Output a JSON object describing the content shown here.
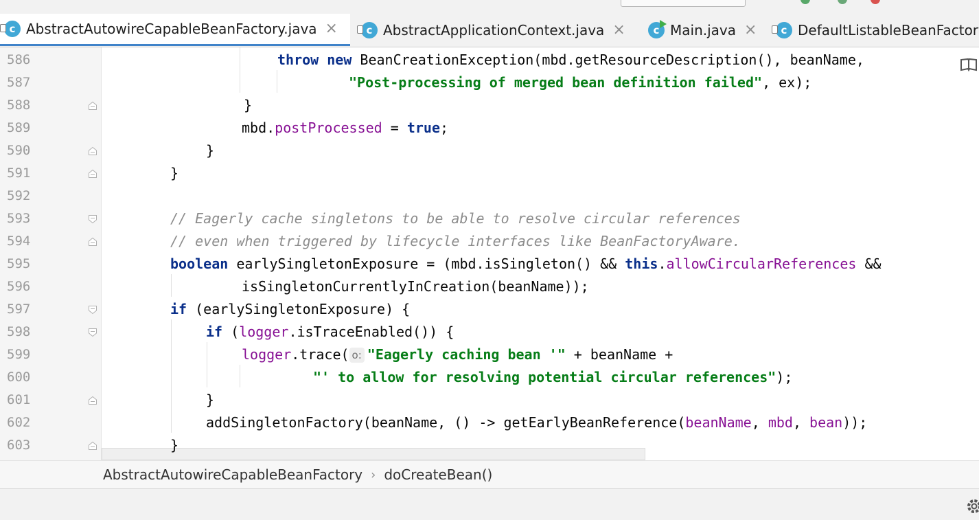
{
  "tabs": [
    {
      "label": "AbstractAutowireCapableBeanFactory.java",
      "icon": "class-icon",
      "active": true
    },
    {
      "label": "AbstractApplicationContext.java",
      "icon": "class-icon",
      "active": false
    },
    {
      "label": "Main.java",
      "icon": "class-run-icon",
      "active": false
    },
    {
      "label": "DefaultListableBeanFactory.java",
      "icon": "class-icon",
      "active": false
    }
  ],
  "editor": {
    "line_numbers": [
      "586",
      "587",
      "588",
      "589",
      "590",
      "591",
      "592",
      "593",
      "594",
      "595",
      "596",
      "597",
      "598",
      "599",
      "600",
      "601",
      "602",
      "603"
    ],
    "lines": [
      [
        {
          "t": "throw",
          "c": "kw"
        },
        {
          "t": " "
        },
        {
          "t": "new",
          "c": "kw"
        },
        {
          "t": " BeanCreationException(mbd.getResourceDescription(), beanName,"
        }
      ],
      [
        {
          "t": "\"Post-processing of merged bean definition failed\"",
          "c": "str"
        },
        {
          "t": ", ex);"
        }
      ],
      [
        {
          "t": "}"
        }
      ],
      [
        {
          "t": "mbd."
        },
        {
          "t": "postProcessed",
          "c": "fld"
        },
        {
          "t": " = "
        },
        {
          "t": "true",
          "c": "kw"
        },
        {
          "t": ";"
        }
      ],
      [
        {
          "t": "}"
        }
      ],
      [
        {
          "t": "}"
        }
      ],
      [],
      [
        {
          "t": "// Eagerly cache singletons to be able to resolve circular references",
          "c": "cmt"
        }
      ],
      [
        {
          "t": "// even when triggered by lifecycle interfaces like BeanFactoryAware.",
          "c": "cmt"
        }
      ],
      [
        {
          "t": "boolean",
          "c": "kw"
        },
        {
          "t": " earlySingletonExposure = (mbd.isSingleton() && "
        },
        {
          "t": "this",
          "c": "kw"
        },
        {
          "t": "."
        },
        {
          "t": "allowCircularReferences",
          "c": "fld"
        },
        {
          "t": " &&"
        }
      ],
      [
        {
          "t": "isSingletonCurrentlyInCreation(beanName));"
        }
      ],
      [
        {
          "t": "if",
          "c": "kw"
        },
        {
          "t": " (earlySingletonExposure) {"
        }
      ],
      [
        {
          "t": "if",
          "c": "kw"
        },
        {
          "t": " ("
        },
        {
          "t": "logger",
          "c": "fld"
        },
        {
          "t": ".isTraceEnabled()) {"
        }
      ],
      [
        {
          "t": "logger",
          "c": "fld"
        },
        {
          "t": ".trace("
        },
        {
          "t": "o:",
          "c": "hint"
        },
        {
          "t": "\"Eagerly caching bean '\"",
          "c": "str"
        },
        {
          "t": " + beanName +"
        }
      ],
      [
        {
          "t": "\"' to allow for resolving potential circular references\"",
          "c": "str"
        },
        {
          "t": ");"
        }
      ],
      [
        {
          "t": "}"
        }
      ],
      [
        {
          "t": "addSingletonFactory(beanName, () -> getEarlyBeanReference("
        },
        {
          "t": "beanName",
          "c": "fld"
        },
        {
          "t": ", "
        },
        {
          "t": "mbd",
          "c": "fld"
        },
        {
          "t": ", "
        },
        {
          "t": "bean",
          "c": "fld"
        },
        {
          "t": "));"
        }
      ],
      [
        {
          "t": "}"
        }
      ]
    ]
  },
  "breadcrumb": {
    "class_name": "AbstractAutowireCapableBeanFactory",
    "method_name": "doCreateBean()"
  },
  "colors": {
    "keyword": "#0a2f8a",
    "string": "#067d17",
    "field": "#871094",
    "comment": "#8c8c8c",
    "tab_underline": "#4083c9",
    "class_icon": "#41a8d6"
  }
}
